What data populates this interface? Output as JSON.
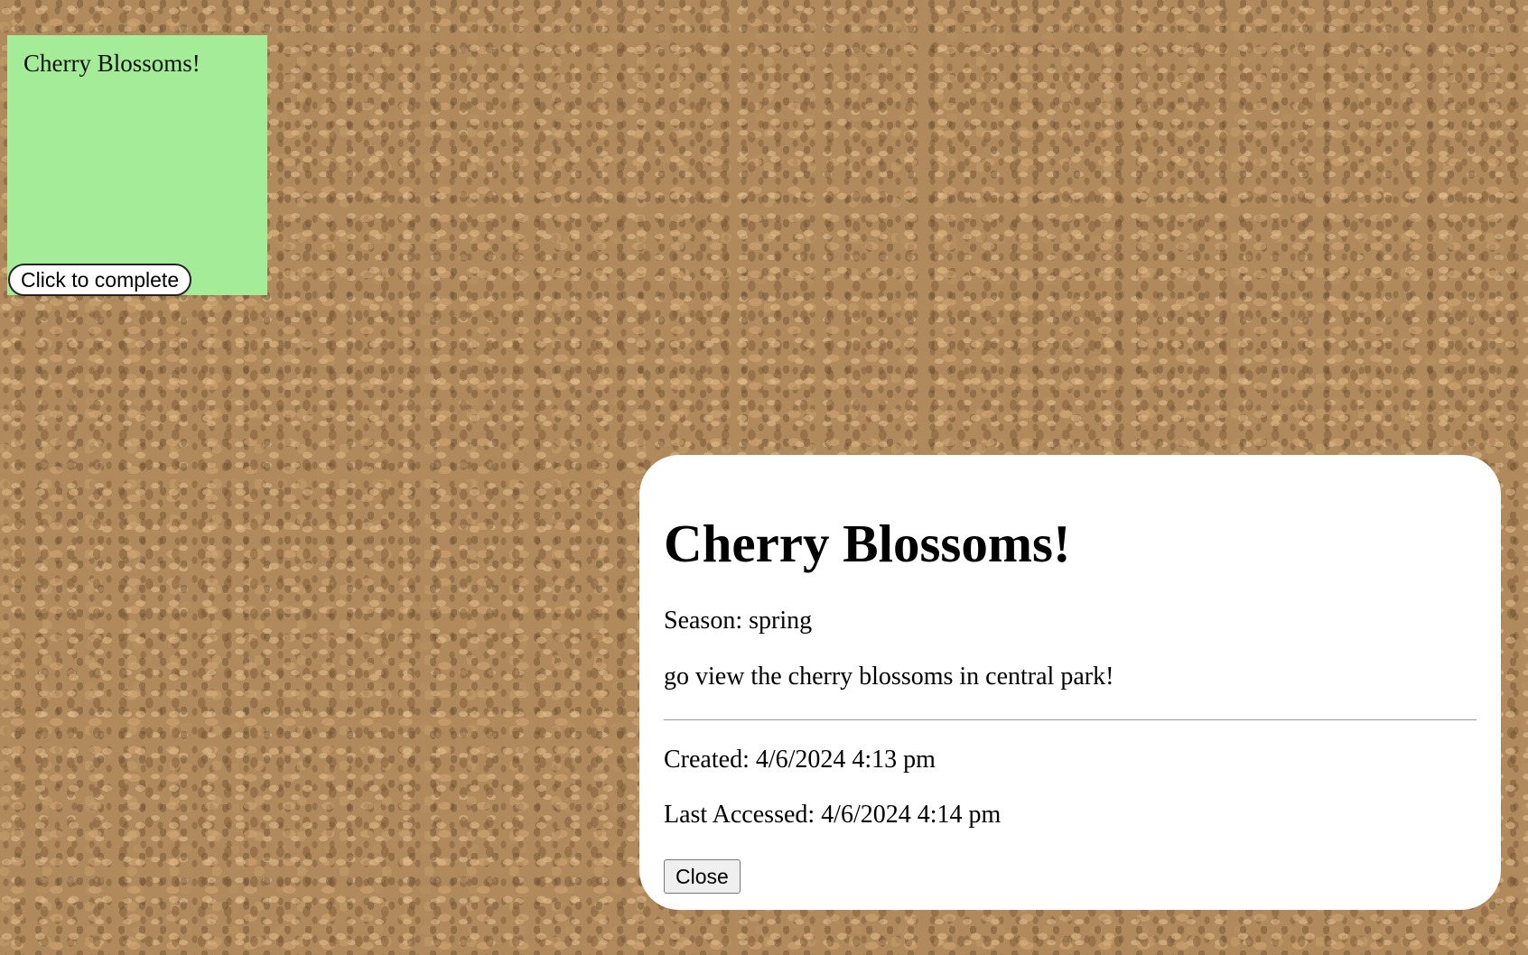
{
  "sticky_note": {
    "title": "Cherry Blossoms!",
    "complete_button_label": "Click to complete",
    "color": "#a4ec98"
  },
  "detail_card": {
    "title": "Cherry Blossoms!",
    "season": "Season: spring",
    "description": "go view the cherry blossoms in central park!",
    "created": "Created: 4/6/2024 4:13 pm",
    "last_accessed": "Last Accessed: 4/6/2024 4:14 pm",
    "close_button_label": "Close"
  },
  "colors": {
    "background": "#b08a5c",
    "card": "#ffffff"
  }
}
